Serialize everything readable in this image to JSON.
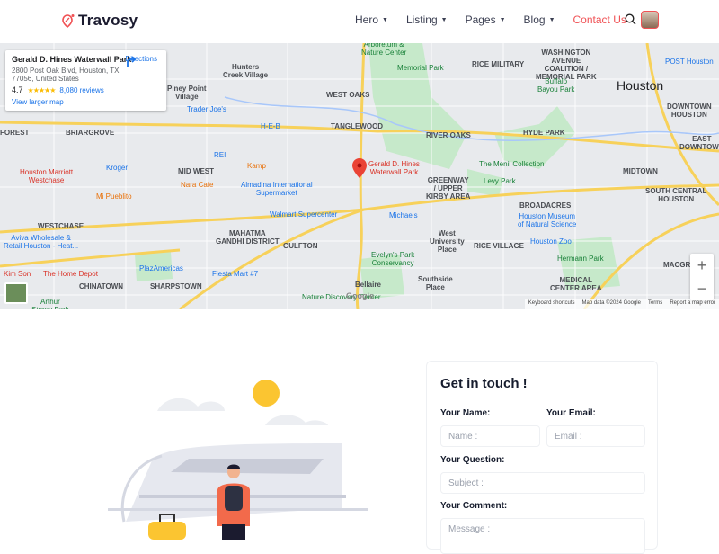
{
  "brand": {
    "name": "Travosy",
    "accent": "#f05154"
  },
  "nav": {
    "items": [
      {
        "label": "Hero"
      },
      {
        "label": "Listing"
      },
      {
        "label": "Pages"
      },
      {
        "label": "Blog"
      }
    ],
    "contact": "Contact Us",
    "search_icon": "search-icon"
  },
  "map": {
    "card": {
      "title": "Gerald D. Hines Waterwall Park",
      "address1": "2800 Post Oak Blvd, Houston, TX",
      "address2": "77056, United States",
      "rating": "4.7",
      "stars": "★★★★★",
      "reviews": "8,080 reviews",
      "larger": "View larger map",
      "directions": "Directions"
    },
    "labels": {
      "hunters": "Hunters\nCreek Village",
      "piney": "Piney Point\nVillage",
      "westoaks": "WEST OAKS",
      "tanglewood": "TANGLEWOOD",
      "rivoaks": "RIVER OAKS",
      "hyde": "HYDE PARK",
      "ricemil": "RICE MILITARY",
      "washington": "WASHINGTON\nAVENUE\nCOALITION /\nMEMORIAL PARK",
      "houston": "Houston",
      "downtown": "DOWNTOWN\nHOUSTON",
      "east": "EAST\nDOWNTOWN",
      "midtown": "MIDTOWN",
      "briargrove": "BRIARGROVE",
      "forest": "FOREST",
      "midwest": "MID WEST",
      "westchase": "WESTCHASE",
      "mahatma": "MAHATMA\nGANDHI DISTRICT",
      "gulfton": "GULFTON",
      "greenway": "GREENWAY\n/ UPPER\nKIRBY AREA",
      "broadacres": "BROADACRES",
      "westu": "West\nUniversity\nPlace",
      "ricevillage": "RICE VILLAGE",
      "southside": "Southside\nPlace",
      "bellaire": "Bellaire",
      "medical": "MEDICAL\nCENTER AREA",
      "southcentral": "SOUTH CENTRAL\nHOUSTON",
      "chinatown": "CHINATOWN",
      "sharpstown": "SHARPSTOWN",
      "macgregor": "MACGREGO"
    },
    "pois": {
      "arboretum": "Arboretum &\nNature Center",
      "memorial": "Memorial Park",
      "buffalo": "Buffalo\nBayou Park",
      "post": "POST Houston",
      "traderjoes": "Trader Joe's",
      "heb": "H-E-B",
      "rei": "REI",
      "kroger": "Kroger",
      "marriott": "Houston Marriott\nWestchase",
      "kamp": "Kamp",
      "waterwall": "Gerald D. Hines\nWaterwall Park",
      "menil": "The Menil Collection",
      "levy": "Levy Park",
      "naracafe": "Nara Cafe",
      "mipueblito": "Mi Pueblito",
      "almadina": "Almadina International\nSupermarket",
      "walmart": "Walmart Supercenter",
      "michaels": "Michaels",
      "museum": "Houston Museum\nof Natural Science",
      "zoo": "Houston Zoo",
      "hermann": "Hermann Park",
      "aviva": "Aviva Wholesale &\nRetail Houston - Heat...",
      "kimson": "Kim Son",
      "homedepot": "The Home Depot",
      "plaza": "PlazAmericas",
      "fiesta": "Fiesta Mart #7",
      "evelyn": "Evelyn's Park\nConservancy",
      "naturediscovery": "Nature Discovery Center",
      "arthur": "Arthur\nStorey Park"
    },
    "attribution": {
      "keyboard": "Keyboard shortcuts",
      "data": "Map data ©2024 Google",
      "terms": "Terms",
      "report": "Report a map error"
    },
    "zoom_in": "+",
    "zoom_out": "−",
    "google": "Google"
  },
  "form": {
    "title": "Get in touch !",
    "name_label": "Your Name:",
    "name_placeholder": "Name :",
    "email_label": "Your Email:",
    "email_placeholder": "Email :",
    "question_label": "Your Question:",
    "question_placeholder": "Subject :",
    "comment_label": "Your Comment:",
    "comment_placeholder": "Message :"
  }
}
